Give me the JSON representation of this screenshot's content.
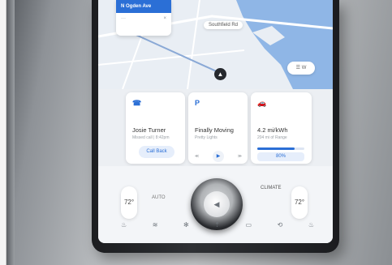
{
  "map": {
    "nav_street": "N Ogden Ave",
    "nav_close": "×",
    "nav_more": "···",
    "road_label": "Southfield Rd",
    "map_button": "W"
  },
  "cards": {
    "phone": {
      "title": "Josie Turner",
      "subtitle": "Missed call | 8:42pm",
      "action": "Call Back"
    },
    "music": {
      "title": "Finally Moving",
      "subtitle": "Pretty Lights",
      "prev": "≪",
      "play": "▶",
      "next": "≫"
    },
    "vehicle": {
      "title": "4.2 mi/kWh",
      "subtitle": "204 mi of Range",
      "progress_percent": 80,
      "progress_label": "80%"
    }
  },
  "climate": {
    "left_temp": "72°",
    "right_temp": "72°",
    "auto_label": "AUTO",
    "climate_label": "CLIMATE"
  },
  "colors": {
    "accent": "#2b6fd6"
  }
}
